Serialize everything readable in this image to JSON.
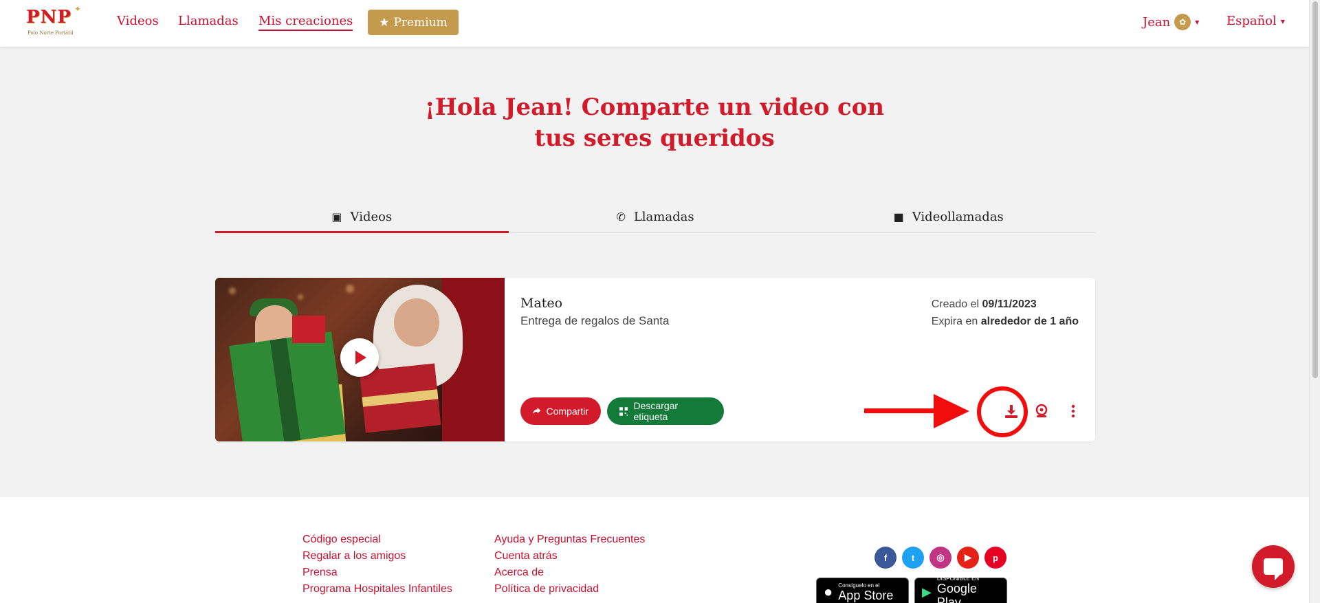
{
  "header": {
    "logo_letters": "PNP",
    "logo_sub": "Polo Norte Portátil",
    "nav": [
      "Videos",
      "Llamadas",
      "Mis creaciones"
    ],
    "premium": "Premium",
    "user": "Jean",
    "language": "Español"
  },
  "hero": {
    "line1": "¡Hola Jean! Comparte un video con",
    "line2": "tus seres queridos"
  },
  "tabs": [
    "Videos",
    "Llamadas",
    "Videollamadas"
  ],
  "card": {
    "name": "Mateo",
    "product": "Entrega de regalos de Santa",
    "created_prefix": "Creado el",
    "created_date": "09/11/2023",
    "expires_prefix": "Expira en",
    "expires_value": "alrededor de 1 año",
    "share_label": "Compartir",
    "label_button": "Descargar etiqueta"
  },
  "footer": {
    "col1": [
      "Código especial",
      "Regalar a los amigos",
      "Prensa",
      "Programa Hospitales Infantiles"
    ],
    "col2": [
      "Ayuda y Preguntas Frecuentes",
      "Cuenta atrás",
      "Acerca de",
      "Política de privacidad"
    ],
    "appstore_small": "Consíguelo en el",
    "appstore_big": "App Store",
    "gplay_small": "DISPONIBLE EN",
    "gplay_big": "Google Play"
  },
  "colors": {
    "brand_red": "#d11a2a",
    "premium_gold": "#c49a4c",
    "label_green": "#137a3a",
    "annotation_red": "#f20d0d"
  }
}
